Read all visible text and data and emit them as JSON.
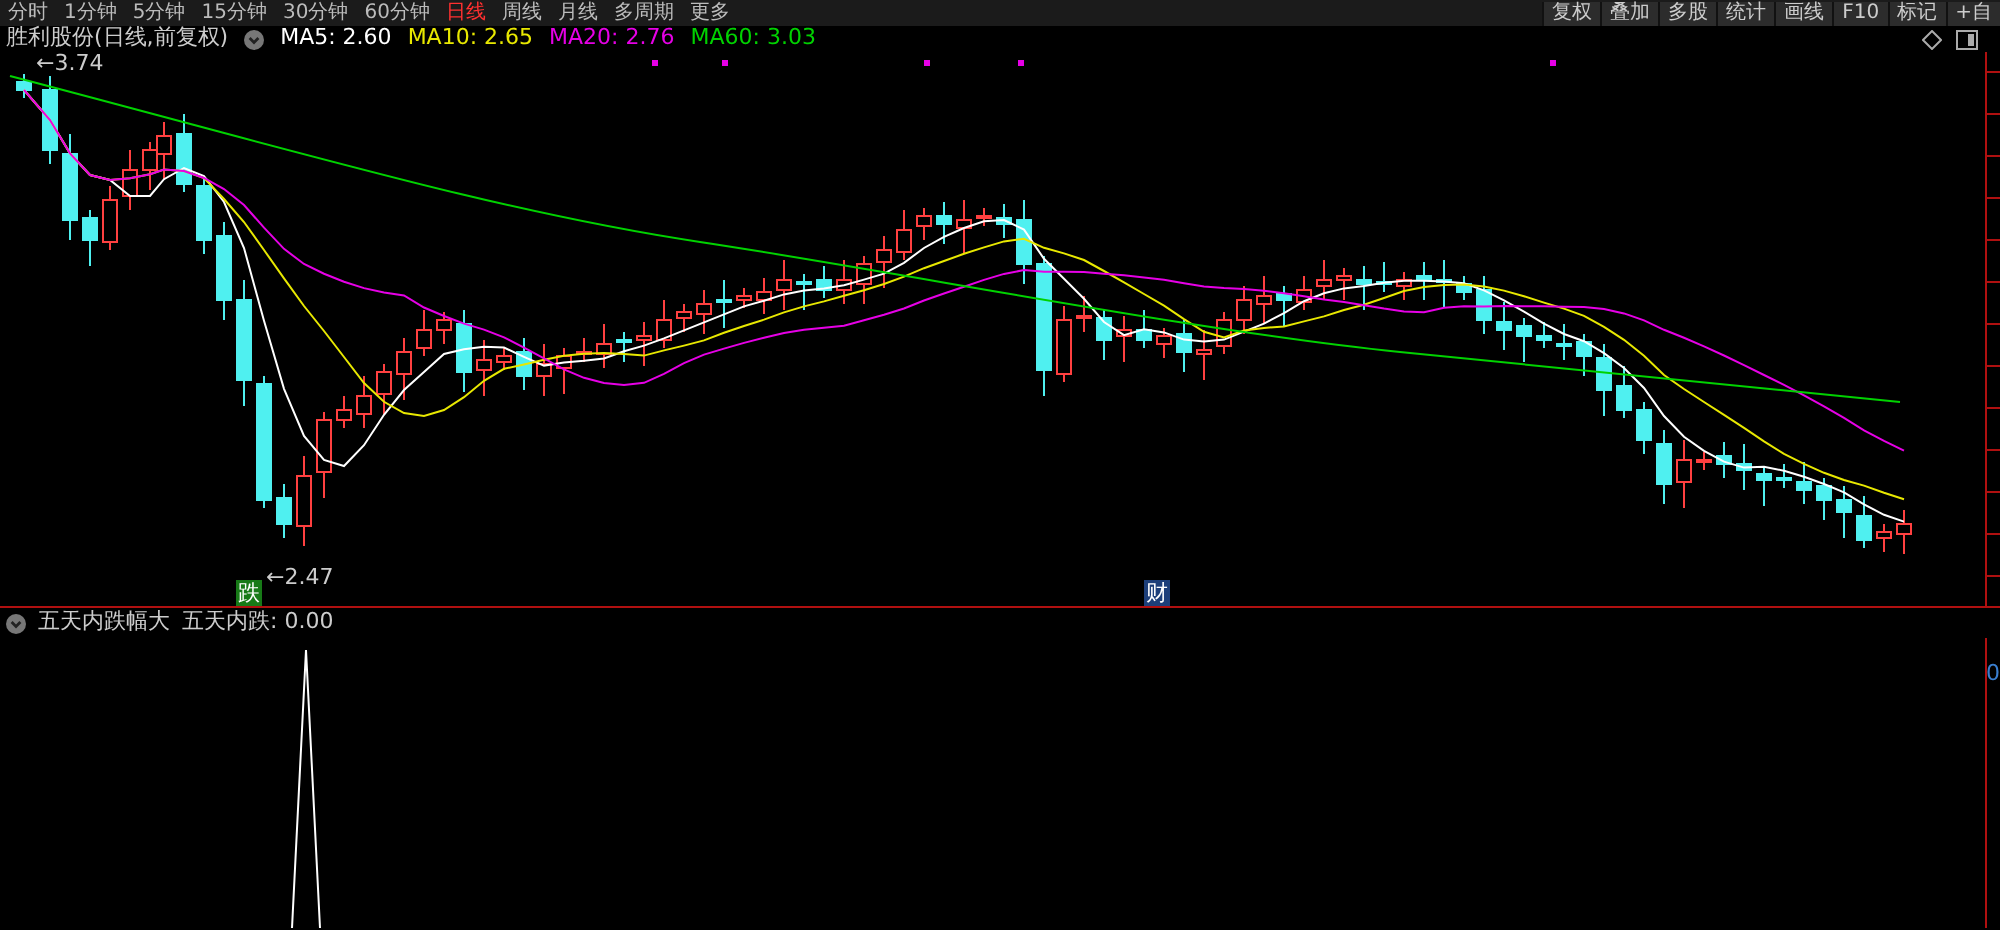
{
  "toolbar": {
    "periods": [
      {
        "label": "分时",
        "selected": false
      },
      {
        "label": "1分钟",
        "selected": false
      },
      {
        "label": "5分钟",
        "selected": false
      },
      {
        "label": "15分钟",
        "selected": false
      },
      {
        "label": "30分钟",
        "selected": false
      },
      {
        "label": "60分钟",
        "selected": false
      },
      {
        "label": "日线",
        "selected": true
      },
      {
        "label": "周线",
        "selected": false
      },
      {
        "label": "月线",
        "selected": false
      },
      {
        "label": "多周期",
        "selected": false
      },
      {
        "label": "更多",
        "selected": false
      }
    ],
    "buttons": [
      "复权",
      "叠加",
      "多股",
      "统计",
      "画线",
      "F10",
      "标记",
      "+自"
    ]
  },
  "price_panel": {
    "title": "胜利股份(日线,前复权)",
    "moving_averages": [
      {
        "label": "MA5: 2.60",
        "color": "#ffffff"
      },
      {
        "label": "MA10: 2.65",
        "color": "#e8e800"
      },
      {
        "label": "MA20: 2.76",
        "color": "#e600e6"
      },
      {
        "label": "MA60: 3.03",
        "color": "#00d200"
      }
    ],
    "high_marker": "←3.74",
    "low_marker": "←2.47",
    "event_badges": [
      {
        "text": "跌",
        "color": "#177a17"
      },
      {
        "text": "财",
        "color": "#1d3f7a"
      }
    ]
  },
  "indicator_panel": {
    "title": "五天内跌幅大",
    "reading": "五天内跌: 0.00",
    "axis_label": "0"
  }
}
